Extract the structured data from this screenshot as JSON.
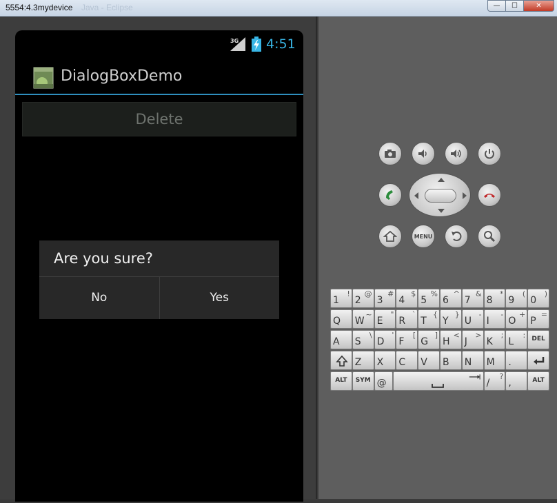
{
  "window": {
    "title": "5554:4.3mydevice",
    "ghost_title": "Java - Eclipse",
    "min_glyph": "—",
    "max_glyph": "☐",
    "close_glyph": "✕"
  },
  "status_bar": {
    "network": "3G",
    "time": "4:51"
  },
  "action_bar": {
    "title": "DialogBoxDemo",
    "icon": "android-app-icon"
  },
  "content": {
    "delete_label": "Delete"
  },
  "dialog": {
    "title": "Are you sure?",
    "no_label": "No",
    "yes_label": "Yes"
  },
  "controls": {
    "menu_label": "MENU",
    "buttons": [
      "camera-icon",
      "volume-down-icon",
      "volume-up-icon",
      "power-icon",
      "call-icon",
      "end-call-icon",
      "home-icon",
      "menu-icon",
      "back-icon",
      "search-icon"
    ]
  },
  "keyboard": {
    "rows": [
      [
        {
          "m": "1",
          "s": "!"
        },
        {
          "m": "2",
          "s": "@"
        },
        {
          "m": "3",
          "s": "#"
        },
        {
          "m": "4",
          "s": "$"
        },
        {
          "m": "5",
          "s": "%"
        },
        {
          "m": "6",
          "s": "^"
        },
        {
          "m": "7",
          "s": "&"
        },
        {
          "m": "8",
          "s": "*"
        },
        {
          "m": "9",
          "s": "("
        },
        {
          "m": "0",
          "s": ")"
        }
      ],
      [
        {
          "m": "Q",
          "s": ""
        },
        {
          "m": "W",
          "s": "~"
        },
        {
          "m": "E",
          "s": "\""
        },
        {
          "m": "R",
          "s": "`"
        },
        {
          "m": "T",
          "s": "{"
        },
        {
          "m": "Y",
          "s": "}"
        },
        {
          "m": "U",
          "s": "-"
        },
        {
          "m": "I",
          "s": "-"
        },
        {
          "m": "O",
          "s": "+"
        },
        {
          "m": "P",
          "s": "="
        }
      ],
      [
        {
          "m": "A",
          "s": ""
        },
        {
          "m": "S",
          "s": "\\"
        },
        {
          "m": "D",
          "s": "'"
        },
        {
          "m": "F",
          "s": "["
        },
        {
          "m": "G",
          "s": "]"
        },
        {
          "m": "H",
          "s": "<"
        },
        {
          "m": "J",
          "s": ">"
        },
        {
          "m": "K",
          "s": ";"
        },
        {
          "m": "L",
          "s": ":"
        }
      ],
      [
        {
          "m": "Z",
          "s": ""
        },
        {
          "m": "X",
          "s": ""
        },
        {
          "m": "C",
          "s": ""
        },
        {
          "m": "V",
          "s": ""
        },
        {
          "m": "B",
          "s": ""
        },
        {
          "m": "N",
          "s": ""
        },
        {
          "m": "M",
          "s": ""
        },
        {
          "m": ".",
          "s": ""
        }
      ],
      [
        {
          "m": "@",
          "s": ""
        },
        {
          "m": "/",
          "s": "?"
        },
        {
          "m": ",",
          "s": ""
        }
      ]
    ],
    "del_label": "DEL",
    "alt_label": "ALT",
    "sym_label": "SYM"
  },
  "colors": {
    "accent": "#39b6e6",
    "dialog_bg": "#282828",
    "panel": "#5e5e5e"
  }
}
